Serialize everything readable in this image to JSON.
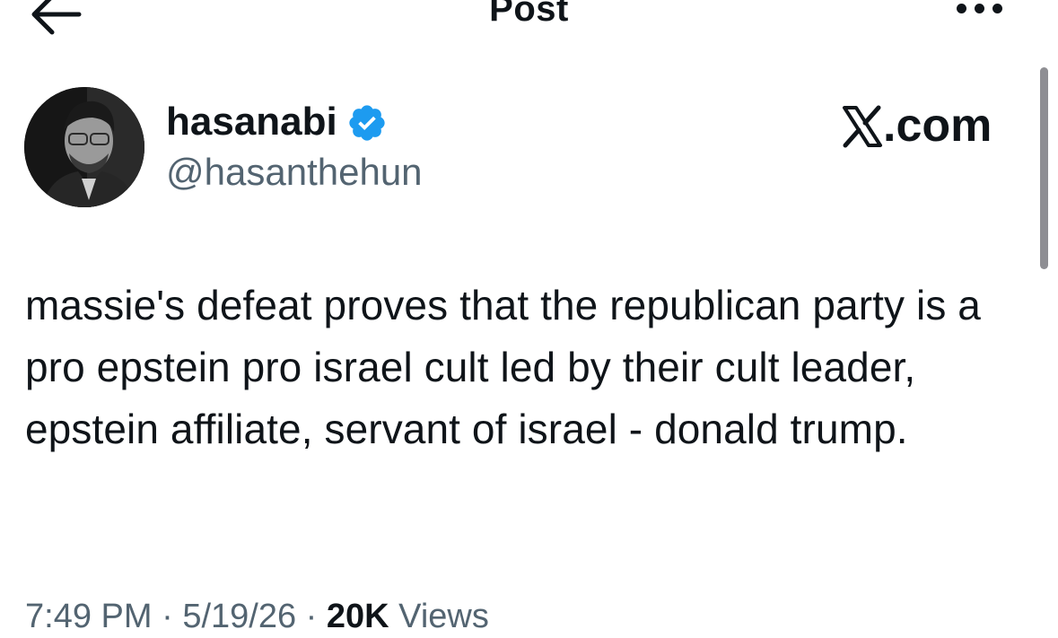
{
  "header": {
    "title": "Post"
  },
  "brand": {
    "label": ".com"
  },
  "author": {
    "name": "hasanabi",
    "handle": "@hasanthehun",
    "verified": true
  },
  "tweet": {
    "text": "massie's defeat proves that the republican party is a pro epstein pro israel cult led by their cult leader, epstein affiliate, servant of israel - donald trump."
  },
  "meta": {
    "time": "7:49 PM",
    "separator": " · ",
    "date": "5/19/26",
    "views_count": "20K",
    "views_label": " Views"
  },
  "colors": {
    "text": "#0f1419",
    "secondary": "#536471",
    "verified": "#1d9bf0",
    "background": "#ffffff"
  },
  "icons": {
    "back": "arrow-left-icon",
    "more": "more-dots-icon",
    "verified": "verified-badge-icon",
    "brand": "x-logo-icon"
  }
}
